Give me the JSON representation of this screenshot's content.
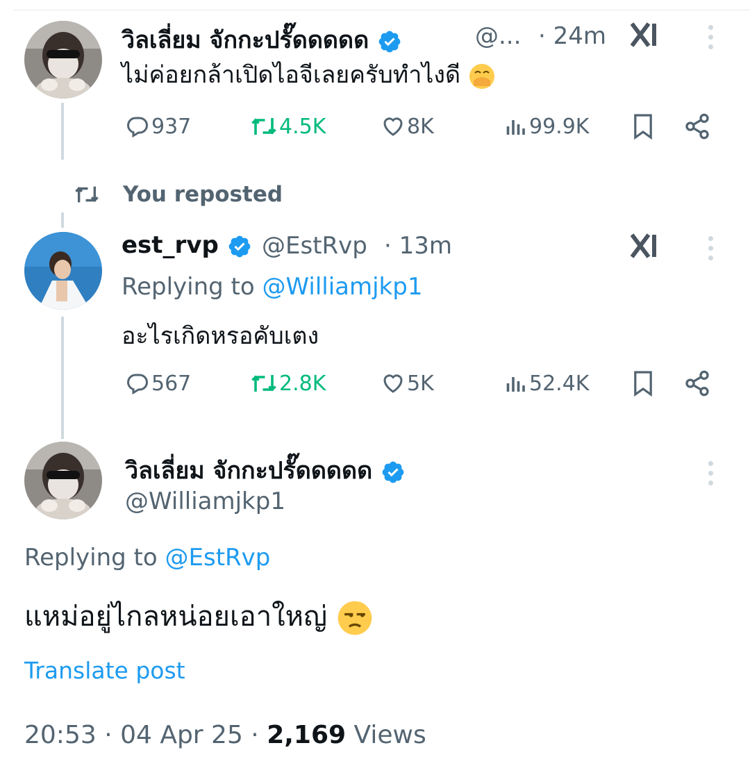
{
  "posts": [
    {
      "display_name": "วิลเลี่ยม จักกะปรั๊ดดดดด",
      "handle": "@...",
      "time": "· 24m",
      "text": "ไม่ค่อยกล้าเปิดไอจีเลยครับทำไงดี",
      "emoji": "face-with-hand-over-mouth",
      "stats": {
        "replies": "937",
        "reposts": "4.5K",
        "likes": "8K",
        "views": "99.9K"
      }
    },
    {
      "repost_label": "You reposted",
      "display_name": "est_rvp",
      "handle": "@EstRvp",
      "time": "· 13m",
      "replying_prefix": "Replying to",
      "replying_handle": "@Williamjkp1",
      "text": "อะไรเกิดหรอคับเตง",
      "stats": {
        "replies": "567",
        "reposts": "2.8K",
        "likes": "5K",
        "views": "52.4K"
      }
    }
  ],
  "main_post": {
    "display_name": "วิลเลี่ยม จักกะปรั๊ดดดดด",
    "handle": "@Williamjkp1",
    "replying_prefix": "Replying to",
    "replying_handle": "@EstRvp",
    "text": "แหม่อยู่ไกลหน่อยเอาใหญ่",
    "emoji": "unamused-face",
    "translate_label": "Translate post",
    "timestamp": "20:53 · 04 Apr 25 ·",
    "views_count": "2,169",
    "views_label": "Views"
  },
  "colors": {
    "accent": "#1d9bf0",
    "repost_green": "#00ba7c",
    "muted": "#536471",
    "text": "#0f1419"
  },
  "icons": [
    "reply-icon",
    "repost-icon",
    "like-icon",
    "views-icon",
    "bookmark-icon",
    "share-icon",
    "grok-icon",
    "more-icon",
    "verified-badge-icon"
  ]
}
